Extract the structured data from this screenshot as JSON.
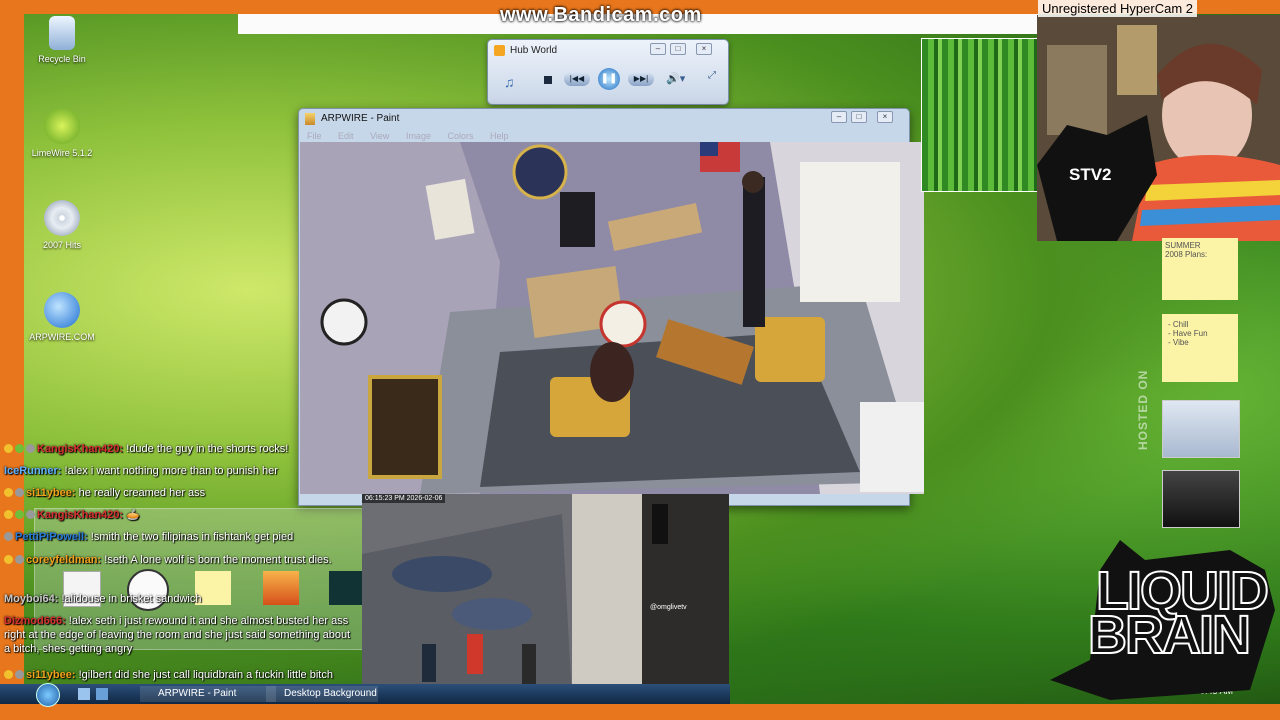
{
  "overlay": {
    "bandicam": "www.Bandicam.com",
    "hypercam": "Unregistered HyperCam 2",
    "stv2": "STV2",
    "liquid_brain": [
      "LIQUID",
      "BRAIN"
    ],
    "hosted_on": "HOSTED ON"
  },
  "desktop_icons": [
    {
      "label": "Recycle Bin",
      "icon": "recycle-bin-icon"
    },
    {
      "label": "LimeWire 5.1.2",
      "icon": "limewire-icon"
    },
    {
      "label": "2007 Hits",
      "icon": "cd-icon"
    },
    {
      "label": "ARPWIRE.COM",
      "icon": "globe-computer-icon"
    }
  ],
  "player": {
    "title": "Hub World"
  },
  "paint": {
    "title": "ARPWIRE - Paint",
    "menu": [
      "File",
      "Edit",
      "View",
      "Image",
      "Colors",
      "Help"
    ]
  },
  "streetcam": {
    "timestamp": "06:15:23 PM 2026-02-06",
    "handle": "@omglivetv"
  },
  "sidebar": {
    "note1": [
      "SUMMER",
      "2008 Plans:"
    ],
    "note2": [
      "- Chill",
      "- Have Fun",
      "- Vibe"
    ]
  },
  "chat": [
    {
      "user": "KangisKhan420:",
      "text": " !dude the guy in the shorts rocks!",
      "color": "#c8282a",
      "badges": 3
    },
    {
      "user": "IceRunner:",
      "text": " !alex i want nothing more than to punish her",
      "color": "#5fb0ff",
      "badges": 0
    },
    {
      "user": "si11ybee:",
      "text": " he really creamed her ass",
      "color": "#f2a21c",
      "badges": 2
    },
    {
      "user": "KangisKhan420:",
      "text": " 🥧",
      "color": "#c8282a",
      "badges": 3
    },
    {
      "user": "PettiPiPowell:",
      "text": " !smith the two filipinas in fishtank get pied",
      "color": "#2a7bd6",
      "badges": 1
    },
    {
      "user": "coreyfeldman:",
      "text": " !seth A lone wolf is born the moment trust dies.",
      "color": "#f2a21c",
      "badges": 2
    },
    {
      "user": "Moyboi64:",
      "text": " !alidouse in brisket sandwich",
      "color": "#c8c8c8",
      "badges": 0
    },
    {
      "user": "Dizmod666:",
      "text": " !alex seth i just rewound it and she almost busted her ass right at the edge of leaving the room and she just said something about a bitch, shes getting angry",
      "color": "#c8282a",
      "badges": 0
    },
    {
      "user": "si11ybee:",
      "text": " !gilbert did she just call liquidbrain a fuckin little bitch",
      "color": "#f2a21c",
      "badges": 2
    }
  ],
  "taskbar": {
    "items": [
      "ARPWIRE - Paint",
      "Desktop Background"
    ],
    "clock": "9:45 AM"
  }
}
